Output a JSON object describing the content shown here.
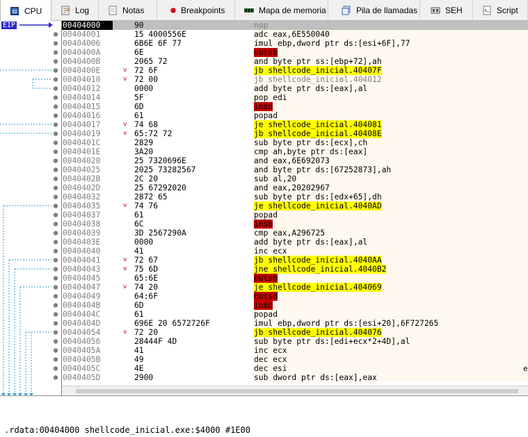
{
  "tabs": [
    {
      "label": "CPU",
      "icon": "cpu-icon",
      "active": true
    },
    {
      "label": "Log",
      "icon": "log-icon"
    },
    {
      "label": "Notas",
      "icon": "notes-icon"
    },
    {
      "label": "Breakpoints",
      "icon": "breakpoint-icon"
    },
    {
      "label": "Mapa de memoria",
      "icon": "memory-map-icon"
    },
    {
      "label": "Pila de llamadas",
      "icon": "call-stack-icon"
    },
    {
      "label": "SEH",
      "icon": "seh-icon"
    },
    {
      "label": "Script",
      "icon": "script-icon"
    }
  ],
  "eip_label": "EIP",
  "rows": [
    {
      "addr": "00404000",
      "jmp": "",
      "bytes": "90",
      "instr": "nop"
    },
    {
      "addr": "00404001",
      "jmp": "",
      "bytes": "15 4000556E",
      "instr": "adc eax,6E550040"
    },
    {
      "addr": "00404006",
      "jmp": "",
      "bytes": "6B6E 6F 77",
      "instr": "imul ebp,dword ptr ds:[esi+6F],77"
    },
    {
      "addr": "0040400A",
      "jmp": "",
      "bytes": "6E",
      "instr": "outsb"
    },
    {
      "addr": "0040400B",
      "jmp": "",
      "bytes": "2065 72",
      "instr": "and byte ptr ss:[ebp+72],ah"
    },
    {
      "addr": "0040400E",
      "jmp": "v",
      "bytes": "72 6F",
      "instr": "jb shellcode_inicial.40407F"
    },
    {
      "addr": "00404010",
      "jmp": "v",
      "bytes": "72 00",
      "instr": "jb shellcode_inicial.404012"
    },
    {
      "addr": "00404012",
      "jmp": "",
      "bytes": "0000",
      "instr": "add byte ptr ds:[eax],al"
    },
    {
      "addr": "00404014",
      "jmp": "",
      "bytes": "5F",
      "instr": "pop edi"
    },
    {
      "addr": "00404015",
      "jmp": "",
      "bytes": "6D",
      "instr": "insd"
    },
    {
      "addr": "00404016",
      "jmp": "",
      "bytes": "61",
      "instr": "popad"
    },
    {
      "addr": "00404017",
      "jmp": "v",
      "bytes": "74 68",
      "instr": "je shellcode_inicial.404081"
    },
    {
      "addr": "00404019",
      "jmp": "v",
      "bytes": "65:72 72",
      "instr": "jb shellcode_inicial.40408E"
    },
    {
      "addr": "0040401C",
      "jmp": "",
      "bytes": "2829",
      "instr": "sub byte ptr ds:[ecx],ch"
    },
    {
      "addr": "0040401E",
      "jmp": "",
      "bytes": "3A20",
      "instr": "cmp ah,byte ptr ds:[eax]"
    },
    {
      "addr": "00404020",
      "jmp": "",
      "bytes": "25 7320696E",
      "instr": "and eax,6E692073"
    },
    {
      "addr": "00404025",
      "jmp": "",
      "bytes": "2025 73282567",
      "instr": "and byte ptr ds:[67252873],ah"
    },
    {
      "addr": "0040402B",
      "jmp": "",
      "bytes": "2C 20",
      "instr": "sub al,20"
    },
    {
      "addr": "0040402D",
      "jmp": "",
      "bytes": "25 67292020",
      "instr": "and eax,20202967"
    },
    {
      "addr": "00404032",
      "jmp": "",
      "bytes": "2872 65",
      "instr": "sub byte ptr ds:[edx+65],dh"
    },
    {
      "addr": "00404035",
      "jmp": "v",
      "bytes": "74 76",
      "instr": "je shellcode_inicial.4040AD"
    },
    {
      "addr": "00404037",
      "jmp": "",
      "bytes": "61",
      "instr": "popad"
    },
    {
      "addr": "00404038",
      "jmp": "",
      "bytes": "6C",
      "instr": "insb"
    },
    {
      "addr": "00404039",
      "jmp": "",
      "bytes": "3D 2567290A",
      "instr": "cmp eax,A296725"
    },
    {
      "addr": "0040403E",
      "jmp": "",
      "bytes": "0000",
      "instr": "add byte ptr ds:[eax],al"
    },
    {
      "addr": "00404040",
      "jmp": "",
      "bytes": "41",
      "instr": "inc ecx"
    },
    {
      "addr": "00404041",
      "jmp": "v",
      "bytes": "72 67",
      "instr": "jb shellcode_inicial.4040AA"
    },
    {
      "addr": "00404043",
      "jmp": "v",
      "bytes": "75 6D",
      "instr": "jne shellcode_inicial.4040B2"
    },
    {
      "addr": "00404045",
      "jmp": "",
      "bytes": "65:6E",
      "instr": "outsb"
    },
    {
      "addr": "00404047",
      "jmp": "v",
      "bytes": "74 20",
      "instr": "je shellcode_inicial.404069"
    },
    {
      "addr": "00404049",
      "jmp": "",
      "bytes": "64:6F",
      "instr": "outsd"
    },
    {
      "addr": "0040404B",
      "jmp": "",
      "bytes": "6D",
      "instr": "insd"
    },
    {
      "addr": "0040404C",
      "jmp": "",
      "bytes": "61",
      "instr": "popad"
    },
    {
      "addr": "0040404D",
      "jmp": "",
      "bytes": "696E 20 6572726F",
      "instr": "imul ebp,dword ptr ds:[esi+20],6F727265"
    },
    {
      "addr": "00404054",
      "jmp": "v",
      "bytes": "72 20",
      "instr": "jb shellcode_inicial.404076"
    },
    {
      "addr": "00404056",
      "jmp": "",
      "bytes": "28444F 4D",
      "instr": "sub byte ptr ds:[edi+ecx*2+4D],al"
    },
    {
      "addr": "0040405A",
      "jmp": "",
      "bytes": "41",
      "instr": "inc ecx"
    },
    {
      "addr": "0040405B",
      "jmp": "",
      "bytes": "49",
      "instr": "dec ecx"
    },
    {
      "addr": "0040405C",
      "jmp": "",
      "bytes": "4E",
      "instr": "dec esi"
    },
    {
      "addr": "0040405D",
      "jmp": "",
      "bytes": "2900",
      "instr": "sub dword ptr ds:[eax],eax"
    }
  ],
  "edge_char": "e",
  "status": ".rdata:00404000 shellcode_inicial.exe:$4000 #1E00"
}
